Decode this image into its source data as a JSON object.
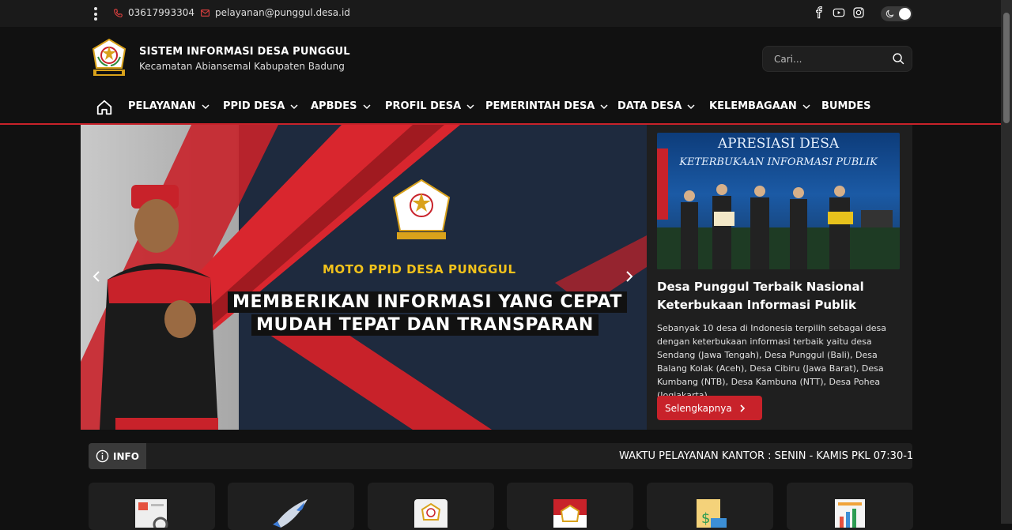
{
  "topbar": {
    "phone": "03617993304",
    "email": "pelayanan@punggul.desa.id"
  },
  "header": {
    "title": "SISTEM INFORMASI DESA PUNGGUL",
    "subtitle": "Kecamatan Abiansemal Kabupaten Badung",
    "search_placeholder": "Cari..."
  },
  "nav": {
    "items": [
      {
        "label": "PELAYANAN"
      },
      {
        "label": "PPID DESA"
      },
      {
        "label": "APBDES"
      },
      {
        "label": "PROFIL DESA"
      },
      {
        "label": "PEMERINTAH DESA"
      },
      {
        "label": "DATA DESA"
      },
      {
        "label": "KELEMBAGAAN"
      },
      {
        "label": "BUMDES"
      }
    ]
  },
  "slider": {
    "moto": "MOTO PPID DESA PUNGGUL",
    "line1": "MEMBERIKAN INFORMASI YANG CEPAT",
    "line2": "MUDAH TEPAT DAN TRANSPARAN"
  },
  "news": {
    "photo_title": "APRESIASI DESA",
    "photo_subtitle": "KETERBUKAAN INFORMASI PUBLIK",
    "title": "Desa Punggul Terbaik Nasional Keterbukaan Informasi Publik",
    "body": "Sebanyak 10 desa di Indonesia terpilih sebagai desa dengan keterbukaan informasi terbaik yaitu desa Sendang (Jawa Tengah), Desa Punggul (Bali), Desa Balang Kolak (Aceh), Desa Cibiru (Jawa Barat), Desa Kumbang (NTB), Desa Kambuna (NTT), Desa Pohea (Jogjakarta),..",
    "button": "Selengkapnya"
  },
  "info": {
    "label": "INFO",
    "ticker": "WAKTU PELAYANAN KANTOR : SENIN - KAMIS PKL 07:30-1"
  },
  "colors": {
    "accent": "#c8222a",
    "background": "#111111",
    "panel": "#1f1f1f",
    "gold": "#f2c21b"
  },
  "icons": [
    "menu-dots-icon",
    "phone-icon",
    "mail-icon",
    "facebook-icon",
    "youtube-icon",
    "instagram-icon",
    "moon-icon",
    "search-icon",
    "home-icon",
    "chevron-down-icon",
    "chevron-left-icon",
    "chevron-right-icon",
    "info-icon"
  ]
}
